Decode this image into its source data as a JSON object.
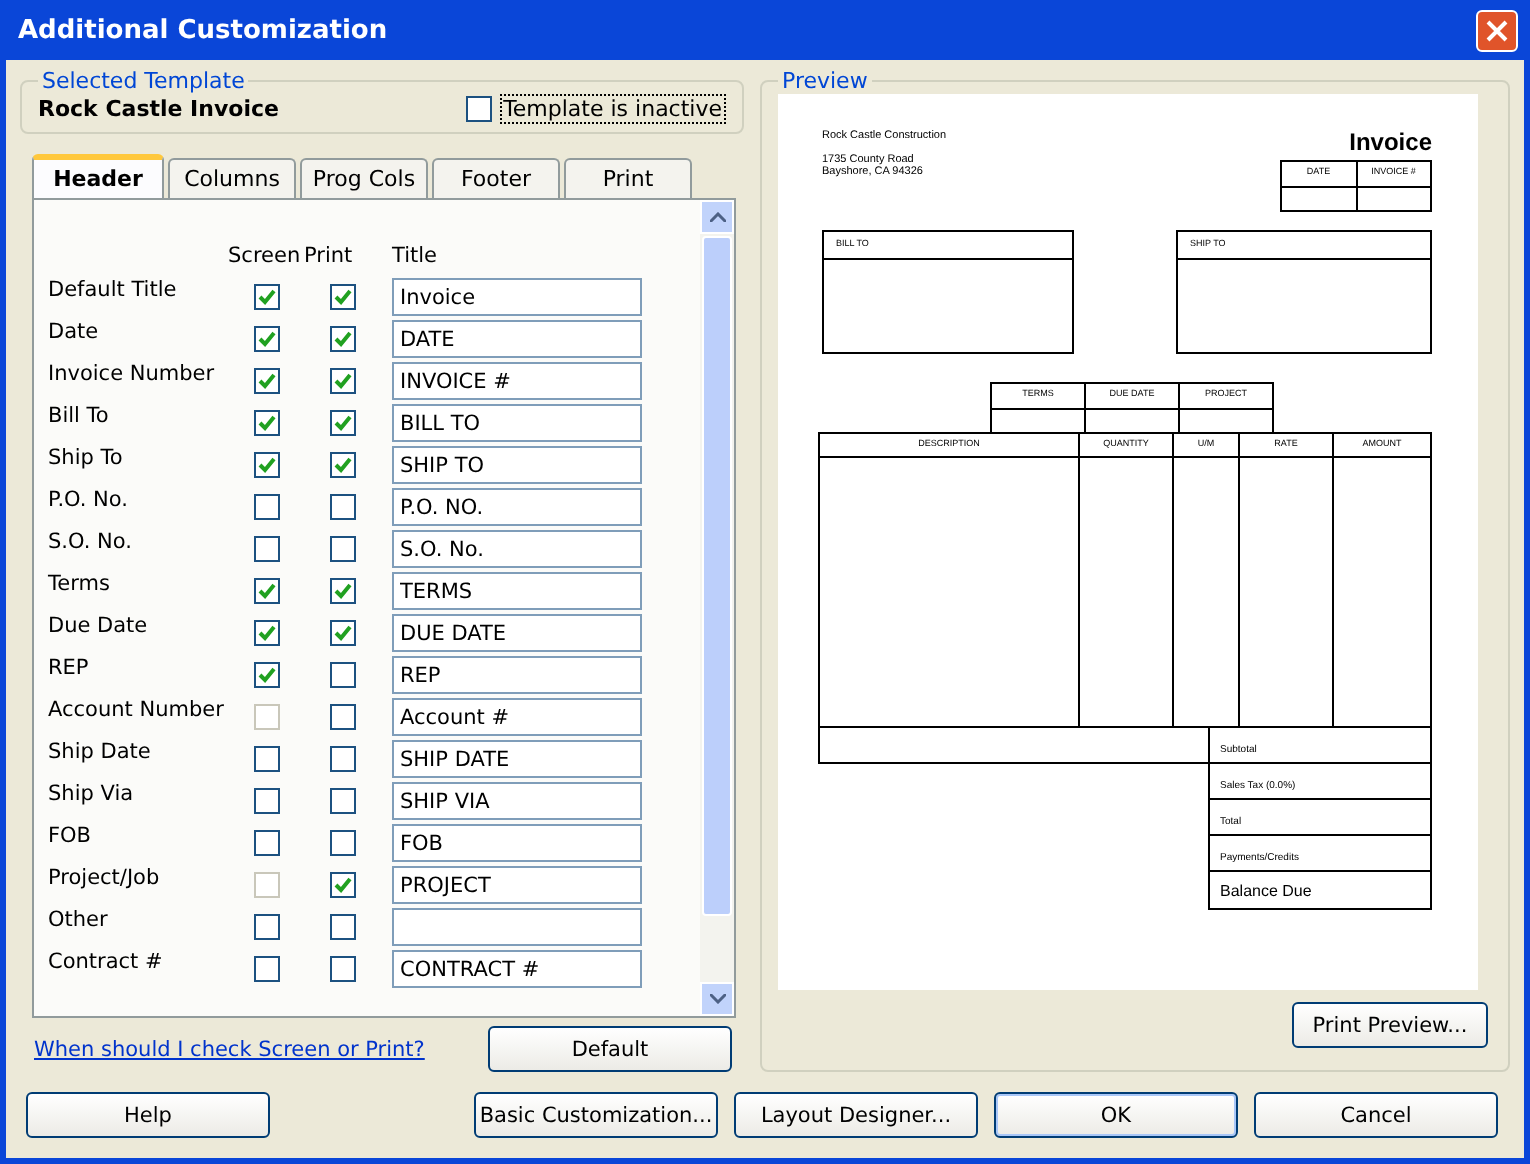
{
  "window": {
    "title": "Additional Customization"
  },
  "selected_template": {
    "legend": "Selected Template",
    "name": "Rock Castle Invoice",
    "inactive": {
      "label": "Template is inactive",
      "checked": false
    }
  },
  "tabs": [
    {
      "label": "Header",
      "selected": true
    },
    {
      "label": "Columns",
      "selected": false
    },
    {
      "label": "Prog Cols",
      "selected": false
    },
    {
      "label": "Footer",
      "selected": false
    },
    {
      "label": "Print",
      "selected": false
    }
  ],
  "columns": [
    "Screen",
    "Print",
    "Title"
  ],
  "fields": [
    {
      "label": "Default Title",
      "screen": {
        "checked": true,
        "disabled": false
      },
      "print": {
        "checked": true,
        "disabled": false
      },
      "title": "Invoice"
    },
    {
      "label": "Date",
      "screen": {
        "checked": true,
        "disabled": false
      },
      "print": {
        "checked": true,
        "disabled": false
      },
      "title": "DATE"
    },
    {
      "label": "Invoice Number",
      "screen": {
        "checked": true,
        "disabled": false
      },
      "print": {
        "checked": true,
        "disabled": false
      },
      "title": "INVOICE #"
    },
    {
      "label": "Bill To",
      "screen": {
        "checked": true,
        "disabled": false
      },
      "print": {
        "checked": true,
        "disabled": false
      },
      "title": "BILL TO"
    },
    {
      "label": "Ship To",
      "screen": {
        "checked": true,
        "disabled": false
      },
      "print": {
        "checked": true,
        "disabled": false
      },
      "title": "SHIP TO"
    },
    {
      "label": "P.O. No.",
      "screen": {
        "checked": false,
        "disabled": false
      },
      "print": {
        "checked": false,
        "disabled": false
      },
      "title": "P.O. NO."
    },
    {
      "label": "S.O. No.",
      "screen": {
        "checked": false,
        "disabled": false
      },
      "print": {
        "checked": false,
        "disabled": false
      },
      "title": "S.O. No."
    },
    {
      "label": "Terms",
      "screen": {
        "checked": true,
        "disabled": false
      },
      "print": {
        "checked": true,
        "disabled": false
      },
      "title": "TERMS"
    },
    {
      "label": "Due Date",
      "screen": {
        "checked": true,
        "disabled": false
      },
      "print": {
        "checked": true,
        "disabled": false
      },
      "title": "DUE DATE"
    },
    {
      "label": "REP",
      "screen": {
        "checked": true,
        "disabled": false
      },
      "print": {
        "checked": false,
        "disabled": false
      },
      "title": "REP"
    },
    {
      "label": "Account Number",
      "screen": {
        "checked": false,
        "disabled": true
      },
      "print": {
        "checked": false,
        "disabled": false
      },
      "title": "Account #"
    },
    {
      "label": "Ship Date",
      "screen": {
        "checked": false,
        "disabled": false
      },
      "print": {
        "checked": false,
        "disabled": false
      },
      "title": "SHIP DATE"
    },
    {
      "label": "Ship Via",
      "screen": {
        "checked": false,
        "disabled": false
      },
      "print": {
        "checked": false,
        "disabled": false
      },
      "title": "SHIP VIA"
    },
    {
      "label": "FOB",
      "screen": {
        "checked": false,
        "disabled": false
      },
      "print": {
        "checked": false,
        "disabled": false
      },
      "title": "FOB"
    },
    {
      "label": "Project/Job",
      "screen": {
        "checked": false,
        "disabled": true
      },
      "print": {
        "checked": true,
        "disabled": false
      },
      "title": "PROJECT"
    },
    {
      "label": "Other",
      "screen": {
        "checked": false,
        "disabled": false
      },
      "print": {
        "checked": false,
        "disabled": false
      }
    },
    {
      "label": "Contract #",
      "screen": {
        "checked": false,
        "disabled": false
      },
      "print": {
        "checked": false,
        "disabled": false
      },
      "title": "CONTRACT #"
    }
  ],
  "help_link": "When should I check Screen or Print?",
  "default_button": "Default",
  "preview": {
    "legend": "Preview",
    "company": "Rock Castle Construction",
    "address": [
      "1735 County Road",
      "Bayshore, CA 94326"
    ],
    "doc_title": "Invoice",
    "head_columns": [
      "DATE",
      "INVOICE #"
    ],
    "bill_to": "BILL TO",
    "ship_to": "SHIP TO",
    "info_columns": [
      "TERMS",
      "DUE DATE",
      "PROJECT"
    ],
    "item_columns": [
      "DESCRIPTION",
      "QUANTITY",
      "U/M",
      "RATE",
      "AMOUNT"
    ],
    "totals": [
      "Subtotal",
      "Sales Tax (0.0%)",
      "Total",
      "Payments/Credits",
      "Balance Due"
    ],
    "print_preview_button": "Print Preview..."
  },
  "buttons": [
    "Help",
    "Basic Customization...",
    "Layout Designer...",
    "OK",
    "Cancel"
  ]
}
